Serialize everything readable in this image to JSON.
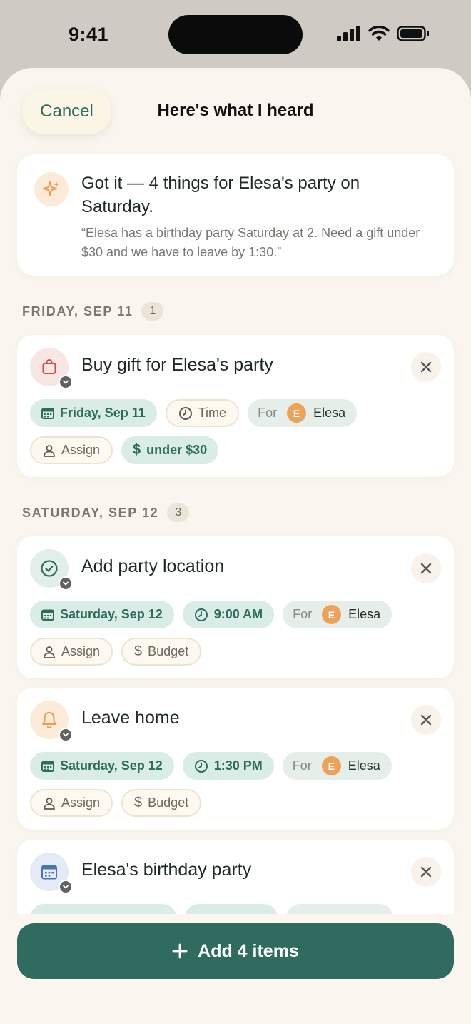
{
  "status": {
    "time": "9:41"
  },
  "header": {
    "cancel_label": "Cancel",
    "title": "Here's what I heard"
  },
  "summary": {
    "icon": "sparkle-icon",
    "headline": "Got it — 4 things for Elesa's party on Saturday.",
    "quote": "“Elesa has a birthday party Saturday at 2. Need a gift under $30 and we have to leave by 1:30.”"
  },
  "sections": [
    {
      "label": "FRIDAY, SEP 11",
      "count": "1"
    },
    {
      "label": "SATURDAY, SEP 12",
      "count": "3"
    }
  ],
  "tasks": [
    {
      "icon": "shopping-bag-icon",
      "title": "Buy gift for Elesa's party",
      "date": "Friday, Sep 11",
      "time": "Time",
      "for_label": "For",
      "person_initial": "E",
      "person": "Elesa",
      "assign": "Assign",
      "budget": "under $30"
    },
    {
      "icon": "check-circle-icon",
      "title": "Add party location",
      "date": "Saturday, Sep 12",
      "time": "9:00 AM",
      "for_label": "For",
      "person_initial": "E",
      "person": "Elesa",
      "assign": "Assign",
      "budget": "Budget"
    },
    {
      "icon": "bell-icon",
      "title": "Leave home",
      "date": "Saturday, Sep 12",
      "time": "1:30 PM",
      "for_label": "For",
      "person_initial": "E",
      "person": "Elesa",
      "assign": "Assign",
      "budget": "Budget"
    },
    {
      "icon": "calendar-icon",
      "title": "Elesa's birthday party"
    }
  ],
  "footer": {
    "add_label": "Add 4 items"
  },
  "colors": {
    "accent": "#2f6b5e",
    "chip_green": "#d9ece6",
    "avatar": "#eda25a",
    "sheet": "#faf6ef"
  }
}
